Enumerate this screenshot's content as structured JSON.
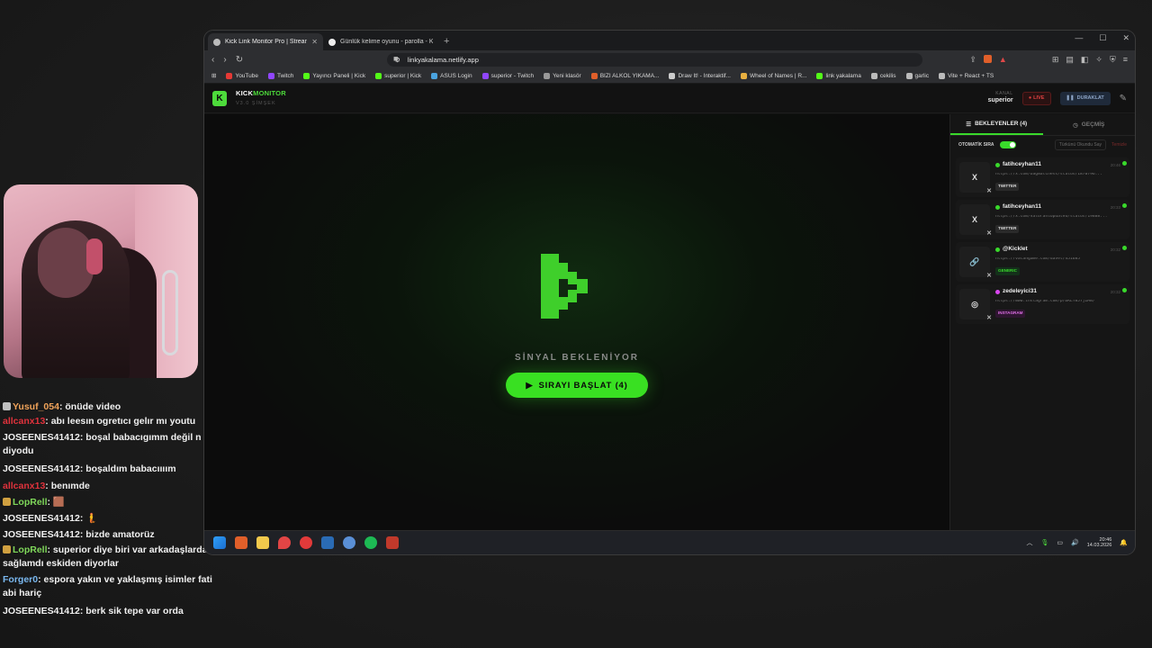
{
  "chat": [
    {
      "user": "Yusuf_054",
      "color": "#f0a35a",
      "text": "önüde video",
      "badge": "#c0c0c0"
    },
    {
      "user": "allcanx13",
      "color": "#e0323c",
      "text": "abı leesın ogretıcı gelır mı youtu"
    },
    {
      "user": "JOSEENES41412",
      "color": "#f0f0f0",
      "text": "boşal babacıgımm değil n sylas diyodu"
    },
    {
      "user": "JOSEENES41412",
      "color": "#f0f0f0",
      "text": "boşaldım babacıııım"
    },
    {
      "user": "allcanx13",
      "color": "#e0323c",
      "text": "benımde"
    },
    {
      "user": "LopRell",
      "color": "#7fd85a",
      "text": "🟫",
      "badge": "#d0a040"
    },
    {
      "user": "JOSEENES41412",
      "color": "#f0f0f0",
      "text": "🧜"
    },
    {
      "user": "JOSEENES41412",
      "color": "#f0f0f0",
      "text": "bizde amatorüz"
    },
    {
      "user": "LopRell",
      "color": "#7fd85a",
      "text": "superior diye biri var arkadaşlarda da sağlamdı eskiden diyorlar",
      "badge": "#d0a040"
    },
    {
      "user": "Forger0",
      "color": "#7ab8f0",
      "text": "espora yakın ve yaklaşmış isimler fati abi hariç"
    },
    {
      "user": "JOSEENES41412",
      "color": "#f0f0f0",
      "text": "berk sik tepe var orda"
    }
  ],
  "browser": {
    "tabs": [
      {
        "title": "Kick Link Monitor Pro | Stream D",
        "active": true
      },
      {
        "title": "Günlük kelime oyunu - parolla - Kel",
        "active": false
      }
    ],
    "url": "linkyakalama.netlify.app",
    "bookmarks": [
      {
        "label": "YouTube",
        "color": "#e53935"
      },
      {
        "label": "Twitch",
        "color": "#9146ff"
      },
      {
        "label": "Yayıncı Paneli | Kick",
        "color": "#53fc18"
      },
      {
        "label": "superior | Kick",
        "color": "#53fc18"
      },
      {
        "label": "ASUS Login",
        "color": "#4aa3df"
      },
      {
        "label": "superior - Twitch",
        "color": "#9146ff"
      },
      {
        "label": "Yeni klasör",
        "color": "#999999"
      },
      {
        "label": "BIZI ALKOL YIKAMA...",
        "color": "#e05f2a"
      },
      {
        "label": "Draw It! - Interaktif...",
        "color": "#cccccc"
      },
      {
        "label": "Wheel of Names | R...",
        "color": "#e8b040"
      },
      {
        "label": "link yakalama",
        "color": "#53fc18"
      },
      {
        "label": "cekilis",
        "color": "#bbbbbb"
      },
      {
        "label": "garlic",
        "color": "#bbbbbb"
      },
      {
        "label": "Vite + React + TS",
        "color": "#bbbbbb"
      }
    ]
  },
  "app": {
    "logo_letter": "K",
    "brand_a": "KICK",
    "brand_b": "MONITOR",
    "version": "V3.0 ŞİMŞEK",
    "channel_label": "KANAL",
    "channel_value": "superior",
    "live_label": "LIVE",
    "pause_label": "DURAKLAT",
    "signal_text": "SİNYAL BEKLENİYOR",
    "start_label": "SIRAYI BAŞLAT (4)",
    "tab_waiting": "BEKLEYENLER (4)",
    "tab_history": "GEÇMİŞ",
    "auto_label": "OTOMATİK SIRA",
    "mode_label": "Türkünü Okundu Say",
    "clear_label": "Temizle",
    "queue": [
      {
        "icon": "X",
        "name": "fatihceyhan11",
        "url": "https://x.com/bagmatchess/status/1870796...",
        "tag": "TWITTER",
        "time": "20:46",
        "status": "#39d92b"
      },
      {
        "icon": "X",
        "name": "fatihceyhan11",
        "url": "https://x.com/ValorantUpdated/status/19888...",
        "tag": "TWITTER",
        "time": "20:33",
        "status": "#39d92b"
      },
      {
        "icon": "🔗",
        "name": "@Kicklet",
        "url": "https://vatangame.com/davet/451685",
        "tag": "GENERIC",
        "time": "20:32",
        "status": "#39d92b"
      },
      {
        "icon": "◎",
        "name": "zedeleyici31",
        "url": "https://www.instagram.com/p/DKLY8J7jZMB/",
        "tag": "INSTAGRAM",
        "time": "20:32",
        "status": "#d946ef"
      }
    ]
  },
  "taskbar": {
    "time": "20:46",
    "date": "14.03.2026"
  }
}
